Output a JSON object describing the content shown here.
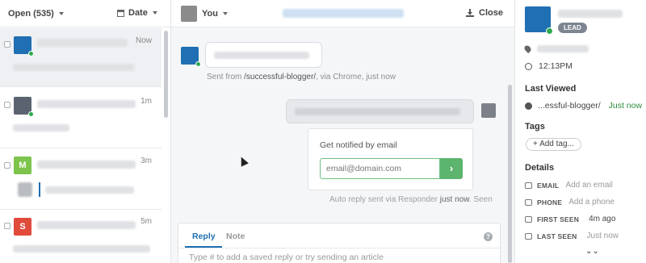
{
  "colors": {
    "brand_blue": "#1f6fb2",
    "online_green": "#2eaa4f",
    "action_green": "#5cb46f"
  },
  "inbox": {
    "filter_label": "Open (535)",
    "sort_label": "Date",
    "conversations": [
      {
        "time": "Now",
        "avatar_letter": "",
        "avatar_color": "#1f6fb2"
      },
      {
        "time": "1m",
        "avatar_letter": "",
        "avatar_color": "#5b6370"
      },
      {
        "time": "3m",
        "avatar_letter": "M",
        "avatar_color": "#7cc44b"
      },
      {
        "time": "5m",
        "avatar_letter": "S",
        "avatar_color": "#e04b3c"
      }
    ]
  },
  "conversation": {
    "assignee_label": "You",
    "close_label": "Close",
    "sent_from_prefix": "Sent from ",
    "sent_from_path": "/successful-blogger/",
    "sent_from_suffix": ", via Chrome, just now",
    "notify_title": "Get notified by email",
    "email_placeholder": "email@domain.com",
    "email_submit": "›",
    "auto_reply_prefix": "Auto reply sent via Responder ",
    "auto_reply_time": "just now",
    "auto_reply_suffix": ". Seen",
    "composer": {
      "tab_reply": "Reply",
      "tab_note": "Note",
      "help": "?",
      "placeholder": "Type # to add a saved reply or try sending an article"
    }
  },
  "profile": {
    "badge": "LEAD",
    "local_time": "12:13PM",
    "last_viewed_heading": "Last Viewed",
    "last_viewed_page": "...essful-blogger/",
    "last_viewed_time": "Just now",
    "tags_heading": "Tags",
    "add_tag_label": "+ Add tag...",
    "details_heading": "Details",
    "details": [
      {
        "label": "EMAIL",
        "value": "Add an email",
        "icon": "envelope-icon"
      },
      {
        "label": "PHONE",
        "value": "Add a phone",
        "icon": "phone-icon"
      },
      {
        "label": "FIRST SEEN",
        "value": "4m ago",
        "icon": "calendar-icon"
      },
      {
        "label": "LAST SEEN",
        "value": "Just now",
        "icon": "calendar-icon"
      }
    ],
    "more_icon": "double-chevron-down-icon"
  }
}
